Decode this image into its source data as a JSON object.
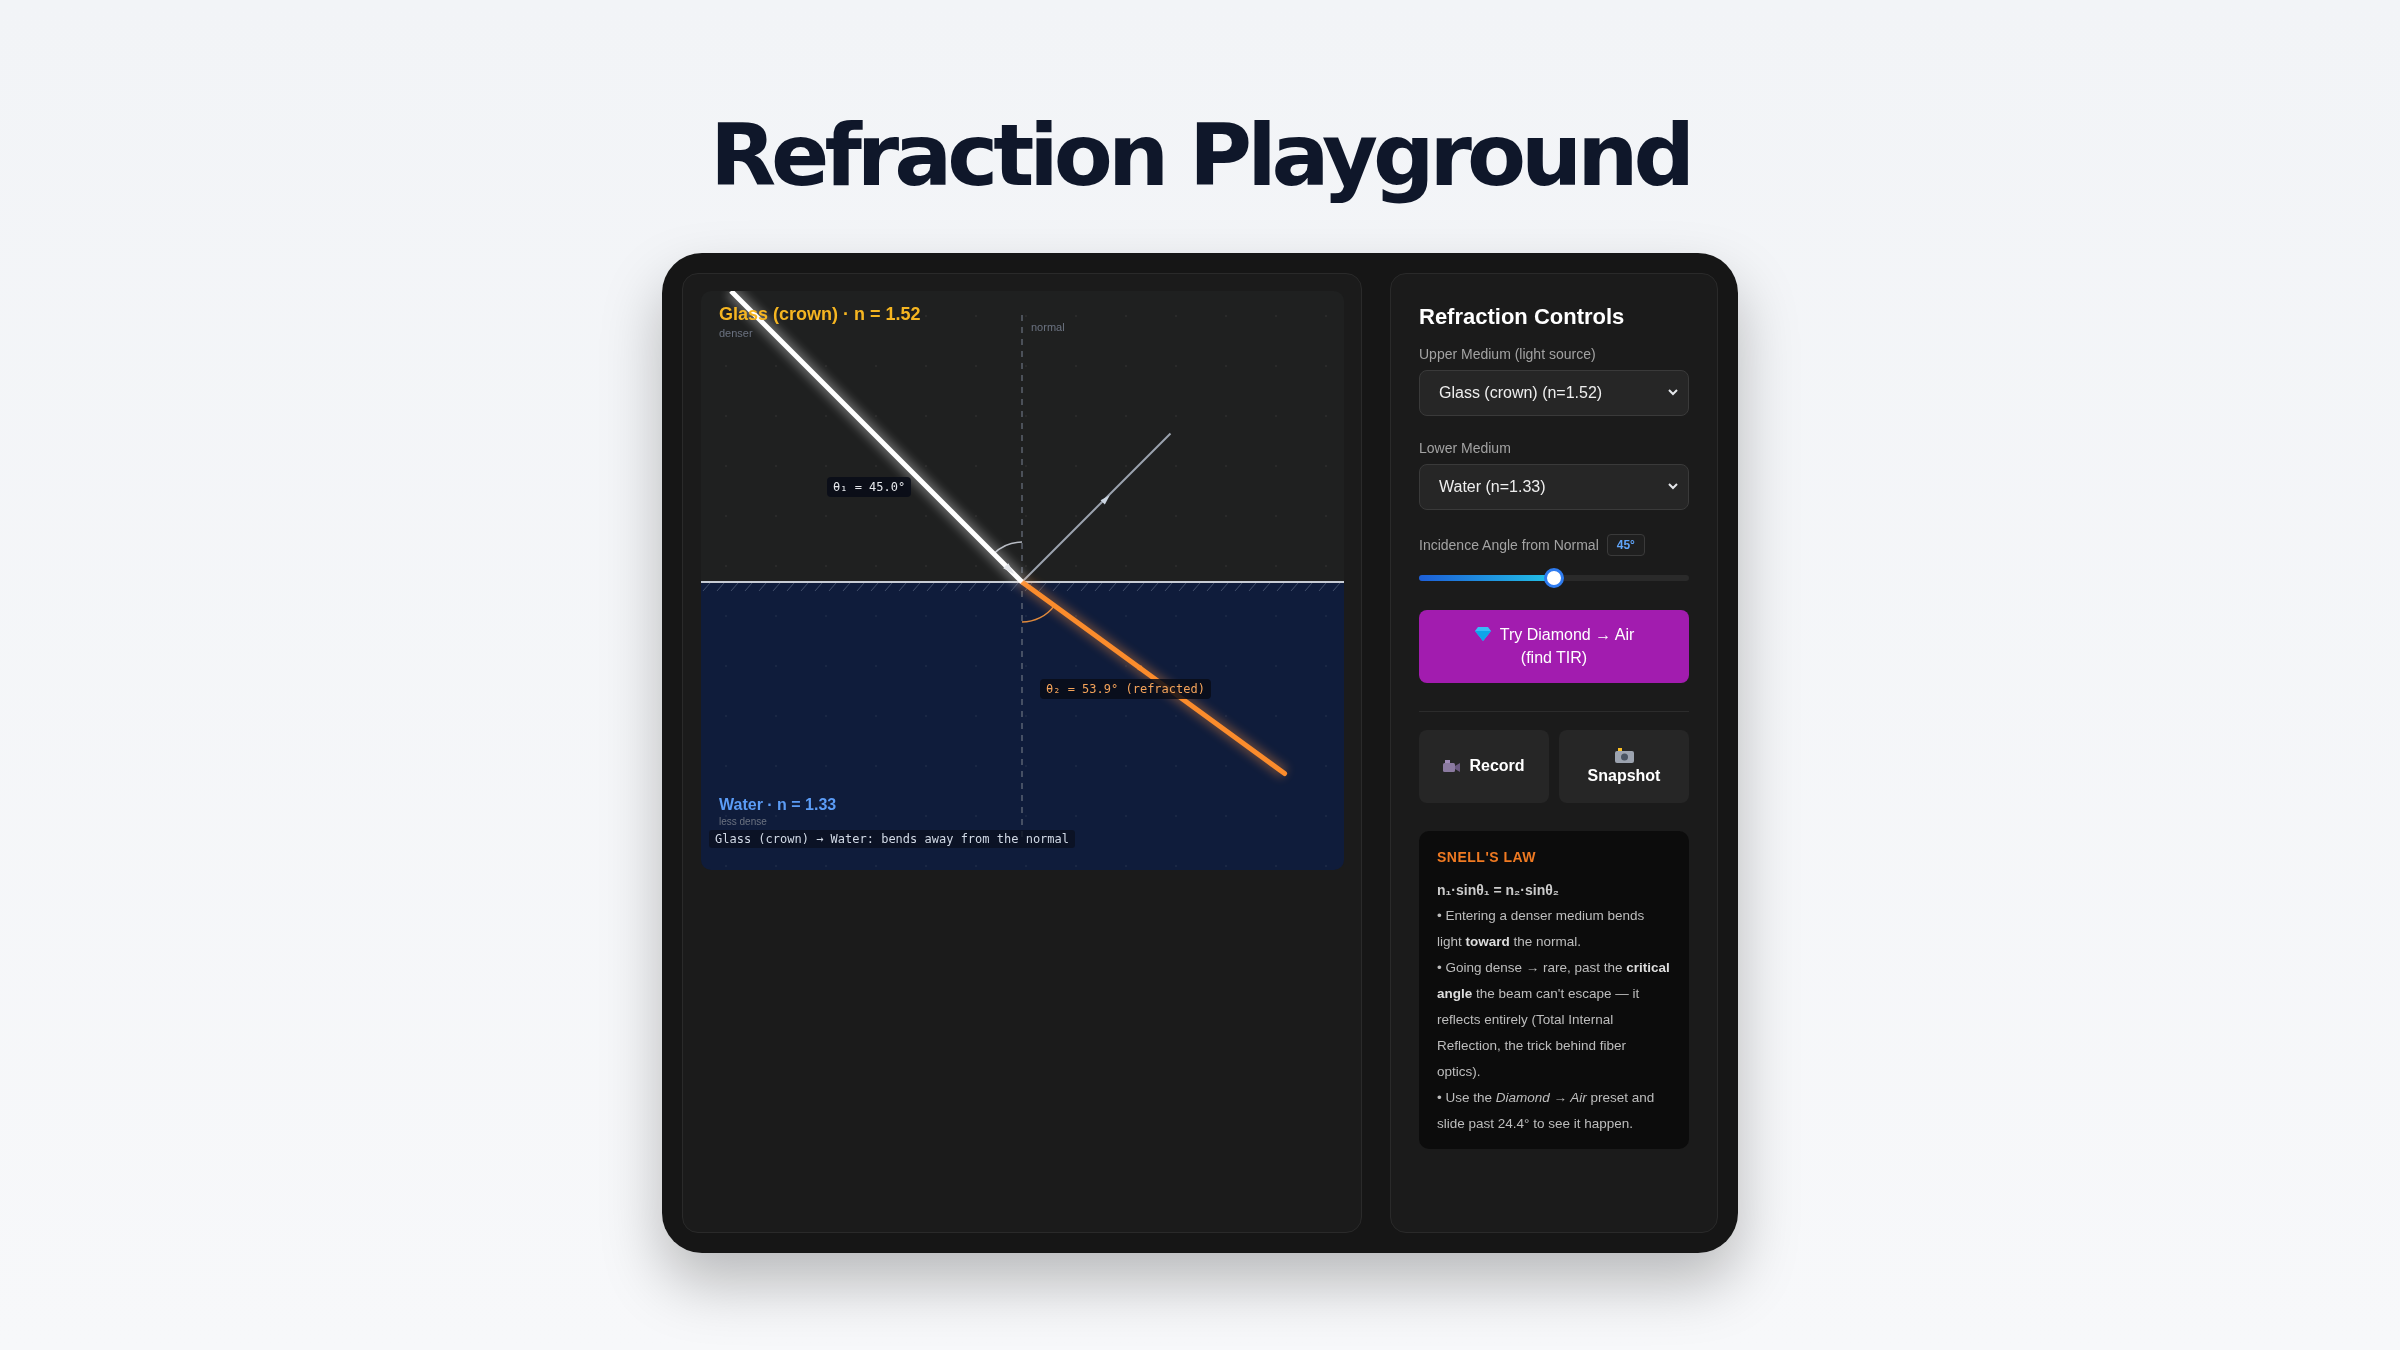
{
  "title": "Refraction Playground",
  "canvas": {
    "upper_label": "Glass (crown) · n = 1.52",
    "upper_note": "denser",
    "normal_label": "normal",
    "incident_label": "θ₁ = 45.0°",
    "refracted_label": "θ₂ = 53.9°  (refracted)",
    "lower_label": "Water · n = 1.33",
    "lower_note": "less dense",
    "caption": "Glass (crown) → Water: bends away from the normal"
  },
  "controls": {
    "title": "Refraction Controls",
    "fields": [
      {
        "label": "Upper Medium (light source)",
        "value": "Glass (crown) (n=1.52)"
      },
      {
        "label": "Lower Medium",
        "value": "Water (n=1.33)"
      }
    ],
    "angle": {
      "label": "Incidence Angle from Normal",
      "reading": "45°",
      "level": 0.5
    },
    "preset_button": "Try Diamond → Air (find TIR)",
    "actions": [
      {
        "kind": "record",
        "label": "Record"
      },
      {
        "kind": "snapshot",
        "label": "Snapshot"
      }
    ],
    "info": {
      "heading": "SNELL'S LAW",
      "formula": "n₁·sinθ₁ = n₂·sinθ₂",
      "lines": [
        "• Entering a denser medium bends light **toward** the normal.",
        "• Going dense → rare, past the **critical angle** the beam can't escape — it reflects entirely (Total Internal Reflection, the trick behind fiber optics).",
        "• Use the *Diamond → Air* preset and slide past 24.4° to see it happen."
      ]
    }
  }
}
